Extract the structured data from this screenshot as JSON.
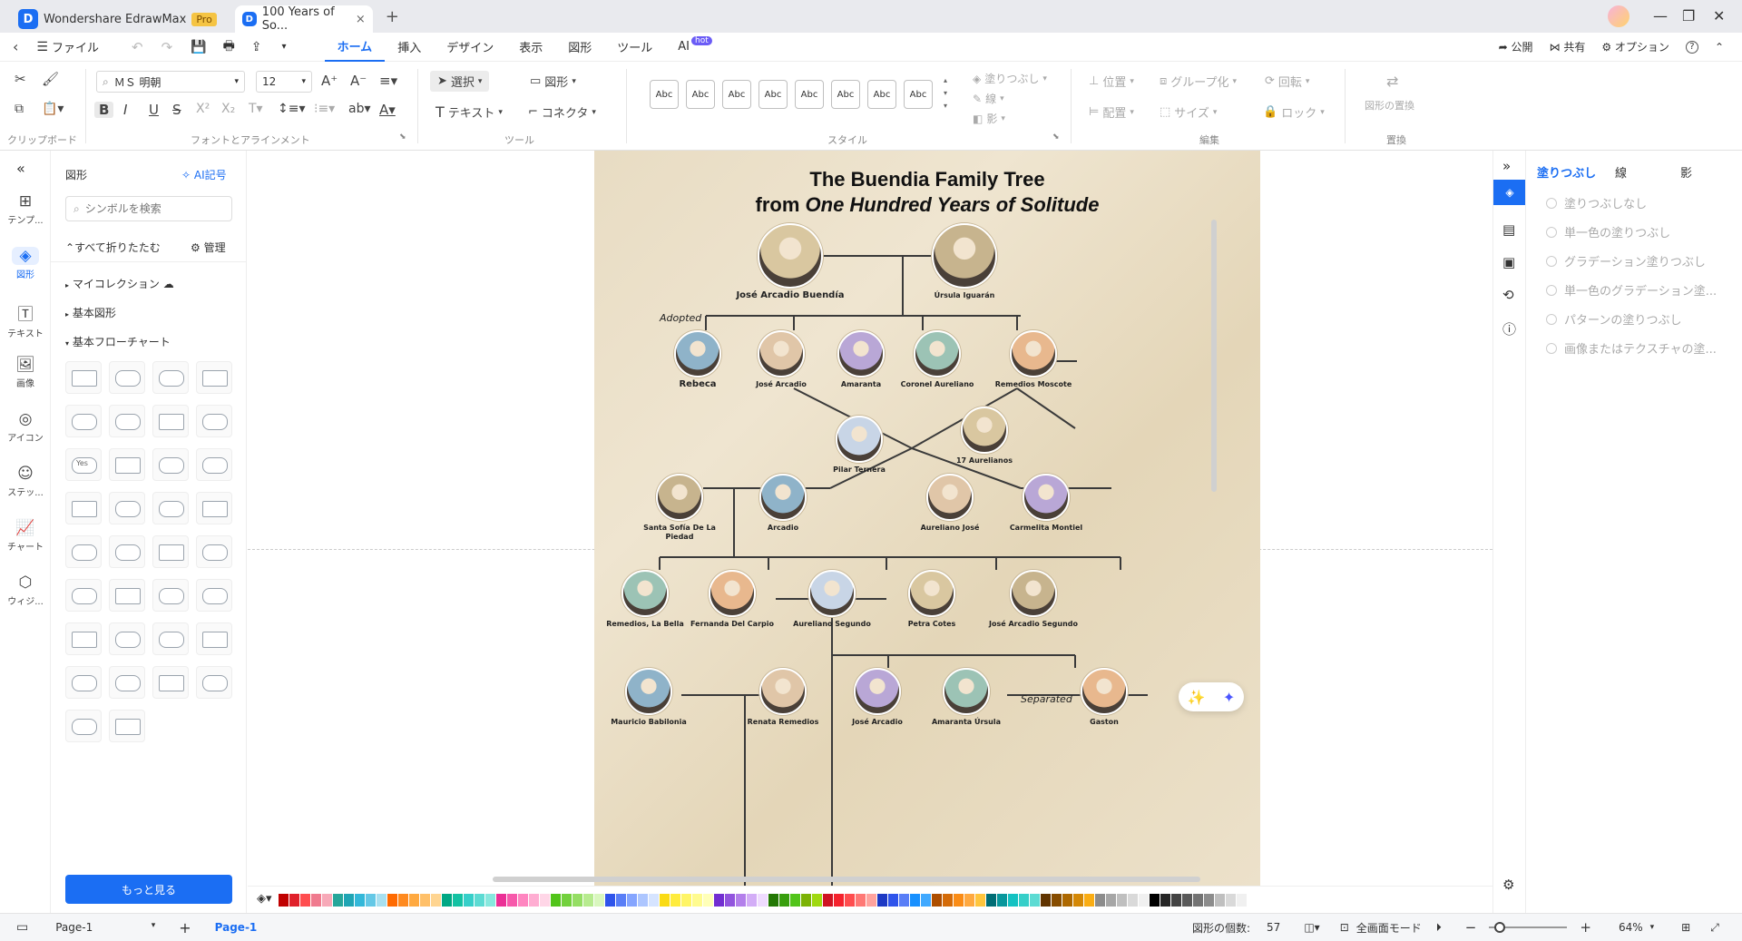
{
  "titlebar": {
    "app_name": "Wondershare EdrawMax",
    "pro_badge": "Pro",
    "doc_tab": "100 Years of So...",
    "close_tab": "×",
    "new_tab": "+"
  },
  "menubar": {
    "file": "ファイル",
    "tabs": [
      "ホーム",
      "挿入",
      "デザイン",
      "表示",
      "図形",
      "ツール",
      "AI"
    ],
    "hot_badge": "hot",
    "publish": "公開",
    "share": "共有",
    "options": "オプション",
    "help": "?"
  },
  "ribbon": {
    "clipboard_label": "クリップボード",
    "font_label": "フォントとアラインメント",
    "font_name": "ＭＳ 明朝",
    "font_size": "12",
    "tools_label": "ツール",
    "select": "選択",
    "shape": "図形",
    "text": "テキスト",
    "connector": "コネクタ",
    "style_label": "スタイル",
    "style_sample": "Abc",
    "fill": "塗りつぶし",
    "line": "線",
    "shadow": "影",
    "edit_label": "編集",
    "position": "位置",
    "group": "グループ化",
    "rotate": "回転",
    "align": "配置",
    "size": "サイズ",
    "lock": "ロック",
    "replace_label": "置換",
    "replace_shape": "図形の置換"
  },
  "leftrail": {
    "items": [
      "テンプ...",
      "図形",
      "テキスト",
      "画像",
      "アイコン",
      "ステッ...",
      "チャート",
      "ウィジ..."
    ]
  },
  "shapepanel": {
    "title": "図形",
    "ai_symbol": "AI記号",
    "search_placeholder": "シンボルを検索",
    "collapse_all": "すべて折りたたむ",
    "manage": "管理",
    "my_collection": "マイコレクション",
    "basic_shapes": "基本図形",
    "basic_flowchart": "基本フローチャート",
    "yes_label": "Yes",
    "more_button": "もっと見る"
  },
  "diagram": {
    "title_line1": "The Buendia Family Tree",
    "title_line2_prefix": "from ",
    "title_line2_italic": "One Hundred Years of Solitude",
    "adopted": "Adopted",
    "separated": "Separated",
    "people": [
      {
        "id": "jab",
        "name": "José Arcadio Buendía"
      },
      {
        "id": "ursula",
        "name": "Úrsula Iguarán"
      },
      {
        "id": "rebeca",
        "name": "Rebeca"
      },
      {
        "id": "ja",
        "name": "José Arcadio"
      },
      {
        "id": "amaranta",
        "name": "Amaranta"
      },
      {
        "id": "coronel",
        "name": "Coronel Aureliano"
      },
      {
        "id": "remedios_m",
        "name": "Remedios Moscote"
      },
      {
        "id": "pilar",
        "name": "Pilar Ternera"
      },
      {
        "id": "aur17",
        "name": "17 Aurelianos"
      },
      {
        "id": "santa",
        "name": "Santa Sofía De La Piedad"
      },
      {
        "id": "arcadio",
        "name": "Arcadio"
      },
      {
        "id": "aur_jose",
        "name": "Aureliano José"
      },
      {
        "id": "carmelita",
        "name": "Carmelita Montiel"
      },
      {
        "id": "remedios_b",
        "name": "Remedios, La Bella"
      },
      {
        "id": "fernanda",
        "name": "Fernanda Del Carpio"
      },
      {
        "id": "aur_seg",
        "name": "Aureliano Segundo"
      },
      {
        "id": "petra",
        "name": "Petra Cotes"
      },
      {
        "id": "jas",
        "name": "José Arcadio Segundo"
      },
      {
        "id": "mauricio",
        "name": "Mauricio Babilonia"
      },
      {
        "id": "renata",
        "name": "Renata Remedios"
      },
      {
        "id": "ja2",
        "name": "José Arcadio"
      },
      {
        "id": "amaranta_u",
        "name": "Amaranta Úrsula"
      },
      {
        "id": "gaston",
        "name": "Gaston"
      }
    ]
  },
  "rightpanel": {
    "tabs": [
      "塗りつぶし",
      "線",
      "影"
    ],
    "fill_options": [
      "塗りつぶしなし",
      "単一色の塗りつぶし",
      "グラデーション塗りつぶし",
      "単一色のグラデーション塗...",
      "パターンの塗りつぶし",
      "画像またはテクスチャの塗..."
    ]
  },
  "statusbar": {
    "page_select": "Page-1",
    "add_page": "+",
    "page_tab": "Page-1",
    "shape_count_label": "図形の個数:",
    "shape_count": "57",
    "fullscreen": "全画面モード",
    "zoom_out": "−",
    "zoom_in": "+",
    "zoom": "64%",
    "zoom_level": 0.64
  },
  "colors": {
    "accent": "#1b6ef3",
    "palette": [
      "#c00000",
      "#e0202a",
      "#ff4d4f",
      "#f07a8e",
      "#f7a9b8",
      "#26a69a",
      "#1fa5b4",
      "#33b8d9",
      "#64c8e6",
      "#a8e0f0",
      "#ff6a00",
      "#ff8a1f",
      "#ffa940",
      "#ffc069",
      "#ffd591",
      "#00a884",
      "#13c2a3",
      "#36cfc9",
      "#5cdbd3",
      "#87e8de",
      "#eb2f96",
      "#f759ab",
      "#ff85c0",
      "#ffadd2",
      "#ffd6e7",
      "#52c41a",
      "#73d13d",
      "#95de64",
      "#b7eb8f",
      "#d9f7be",
      "#2f54eb",
      "#597ef7",
      "#85a5ff",
      "#adc6ff",
      "#d6e4ff",
      "#fadb14",
      "#ffec3d",
      "#fff566",
      "#fffb8f",
      "#ffffb8",
      "#722ed1",
      "#9254de",
      "#b37feb",
      "#d3adf7",
      "#efdbff",
      "#237804",
      "#389e0d",
      "#52c41a",
      "#7cb305",
      "#a0d911",
      "#cf1322",
      "#f5222d",
      "#ff4d4f",
      "#ff7875",
      "#ffa39e",
      "#1d39c4",
      "#2f54eb",
      "#597ef7",
      "#1890ff",
      "#40a9ff",
      "#ad4e00",
      "#d46b08",
      "#fa8c16",
      "#ffa940",
      "#ffc53d",
      "#006d75",
      "#08979c",
      "#13c2c2",
      "#36cfc9",
      "#5cdbd3",
      "#613400",
      "#874d00",
      "#ad6800",
      "#d48806",
      "#faad14",
      "#8c8c8c",
      "#a6a6a6",
      "#bfbfbf",
      "#d9d9d9",
      "#f0f0f0",
      "#000000",
      "#262626",
      "#434343",
      "#595959",
      "#737373",
      "#8c8c8c",
      "#bfbfbf",
      "#d9d9d9",
      "#f0f0f0",
      "#ffffff"
    ]
  }
}
